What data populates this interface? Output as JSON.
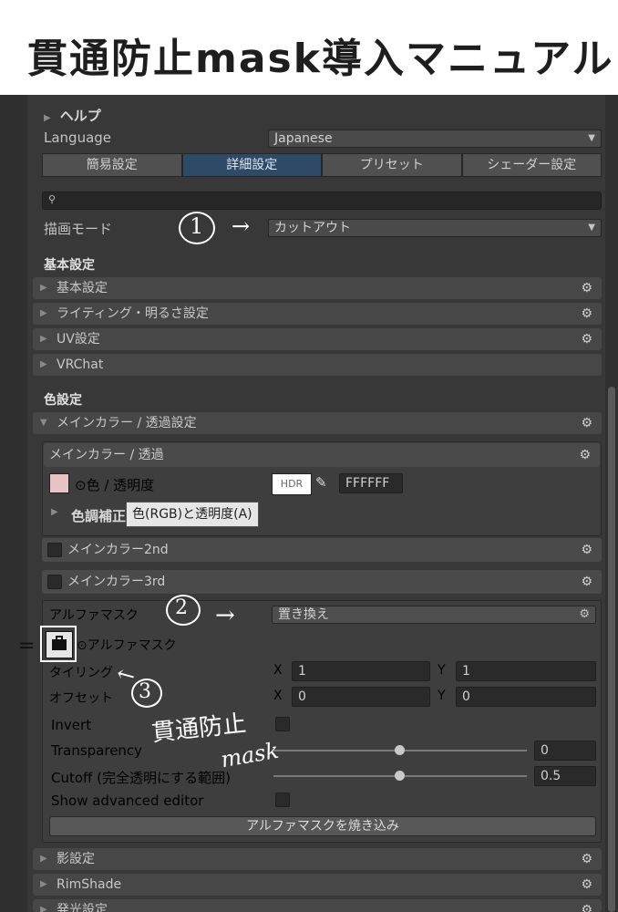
{
  "header": {
    "title": "貫通防止mask導入マニュアル"
  },
  "help": {
    "label": "ヘルプ"
  },
  "language": {
    "label": "Language",
    "value": "Japanese"
  },
  "tabs": [
    {
      "label": "簡易設定",
      "active": false
    },
    {
      "label": "詳細設定",
      "active": true
    },
    {
      "label": "プリセット",
      "active": false
    },
    {
      "label": "シェーダー設定",
      "active": false
    }
  ],
  "render_mode": {
    "label": "描画モード",
    "value": "カットアウト"
  },
  "basic": {
    "title": "基本設定",
    "items": [
      "基本設定",
      "ライティング・明るさ設定",
      "UV設定",
      "VRChat"
    ]
  },
  "color": {
    "title": "色設定",
    "main_fold": "メインカラー / 透過設定",
    "main_sub": "メインカラー / 透過",
    "color_label": "⊙色 / 透明度",
    "hdr": "HDR",
    "hex": "FFFFFF",
    "tone_label": "色調補正",
    "tooltip": "色(RGB)と透明度(A)",
    "main2": "メインカラー2nd",
    "main3": "メインカラー3rd"
  },
  "alpha_mask": {
    "label": "アルファマスク",
    "mode": "置き換え",
    "tex_label": "⊙アルファマスク",
    "tiling_label": "タイリング",
    "offset_label": "オフセット",
    "x_label": "X",
    "y_label": "Y",
    "tiling_x": "1",
    "tiling_y": "1",
    "offset_x": "0",
    "offset_y": "0",
    "invert_label": "Invert",
    "transparency_label": "Transparency",
    "transparency_value": "0",
    "cutoff_label": "Cutoff (完全透明にする範囲)",
    "cutoff_value": "0.5",
    "show_adv_label": "Show advanced editor",
    "bake_button": "アルファマスクを焼き込み"
  },
  "bottom": {
    "items": [
      "影設定",
      "RimShade",
      "発光設定"
    ]
  },
  "annotations": {
    "n1": "1",
    "n2": "2",
    "n3": "3",
    "arrow": "→",
    "handnote1": "貫通防止",
    "handnote2": "mask"
  },
  "icons": {
    "triangle": "triangle-right-icon",
    "gear": "gear-icon",
    "search": "search-icon",
    "eyedropper": "eyedropper-icon"
  }
}
